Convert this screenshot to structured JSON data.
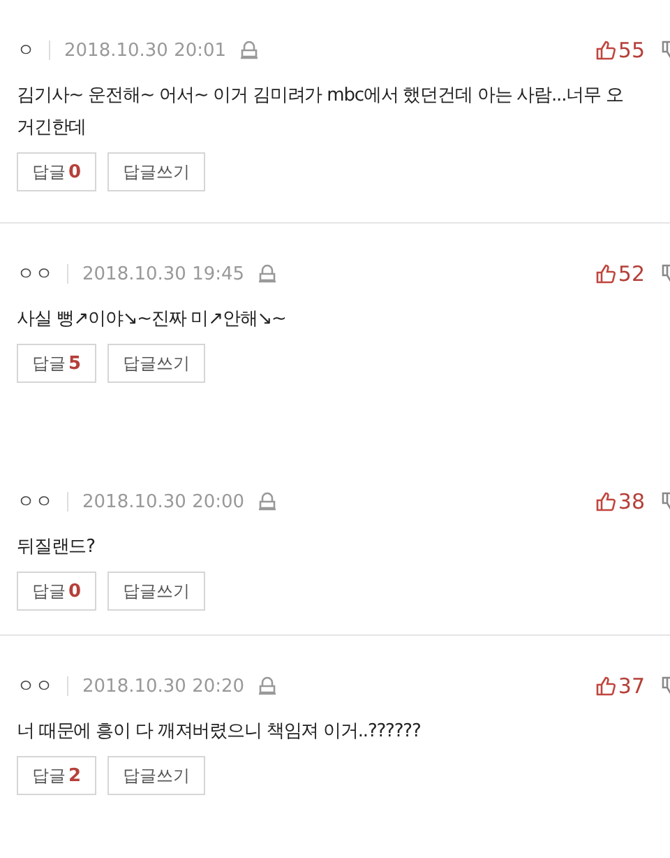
{
  "comments": [
    {
      "author": "ㅇ",
      "date": "2018.10.30 20:01",
      "likes": "55",
      "text": "김기사~ 운전해~ 어서~ 이거 김미려가 mbc에서 했던건데 아는 사람...너무 오\n거긴한데",
      "reply_label": "답글",
      "reply_count": "0",
      "write_label": "답글쓰기",
      "divider_after": true
    },
    {
      "author": "ㅇㅇ",
      "date": "2018.10.30 19:45",
      "likes": "52",
      "text": "사실 뻥↗이야↘~진짜 미↗안해↘~",
      "reply_label": "답글",
      "reply_count": "5",
      "write_label": "답글쓰기",
      "divider_after": false
    },
    {
      "author": "ㅇㅇ",
      "date": "2018.10.30 20:00",
      "likes": "38",
      "text": "뒤질랜드?",
      "reply_label": "답글",
      "reply_count": "0",
      "write_label": "답글쓰기",
      "divider_after": true
    },
    {
      "author": "ㅇㅇ",
      "date": "2018.10.30 20:20",
      "likes": "37",
      "text": "너 때문에 흥이 다 깨져버렸으니 책임져 이거..??????",
      "reply_label": "답글",
      "reply_count": "2",
      "write_label": "답글쓰기",
      "divider_after": false
    }
  ]
}
